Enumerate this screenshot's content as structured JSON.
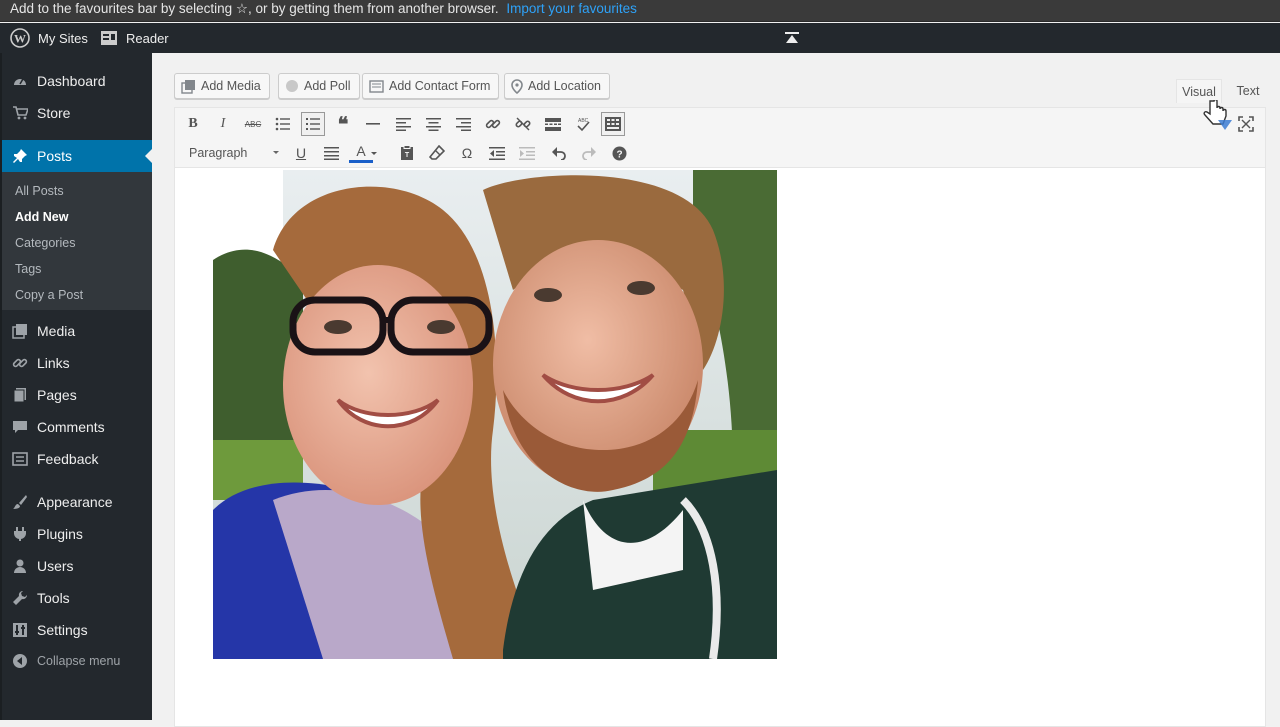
{
  "favourites_bar": {
    "text": "Add to the favourites bar by selecting ☆, or by getting them from another browser.",
    "link": "Import your favourites"
  },
  "admin_bar": {
    "my_sites": "My Sites",
    "reader": "Reader"
  },
  "sidebar": {
    "dashboard": "Dashboard",
    "store": "Store",
    "posts": "Posts",
    "submenu": {
      "all_posts": "All Posts",
      "add_new": "Add New",
      "categories": "Categories",
      "tags": "Tags",
      "copy_post": "Copy a Post"
    },
    "media": "Media",
    "links": "Links",
    "pages": "Pages",
    "comments": "Comments",
    "feedback": "Feedback",
    "appearance": "Appearance",
    "plugins": "Plugins",
    "users": "Users",
    "tools": "Tools",
    "settings": "Settings",
    "collapse": "Collapse menu"
  },
  "media_buttons": {
    "add_media": "Add Media",
    "add_poll": "Add Poll",
    "add_contact_form": "Add Contact Form",
    "add_location": "Add Location"
  },
  "editor_tabs": {
    "visual": "Visual",
    "text": "Text"
  },
  "toolbar": {
    "bold": "B",
    "italic": "I",
    "strike": "ABC",
    "underline": "U",
    "text_color": "A",
    "omega": "Ω",
    "format_value": "Paragraph"
  },
  "colors": {
    "admin_bg": "#23282d",
    "accent": "#0073aa",
    "link": "#2ea2f8"
  }
}
